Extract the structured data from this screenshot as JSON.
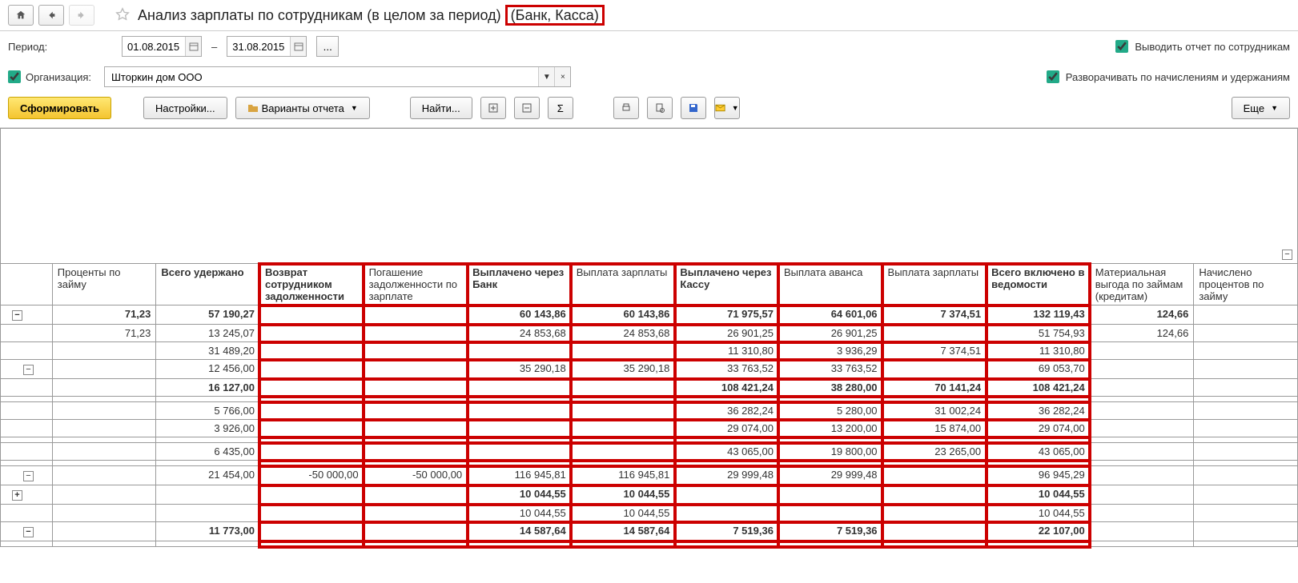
{
  "header": {
    "title_main": "Анализ зарплаты по сотрудникам (в целом за период)",
    "title_highlight": "(Банк, Касса)"
  },
  "period": {
    "label": "Период:",
    "from": "01.08.2015",
    "to": "31.08.2015"
  },
  "org": {
    "label": "Организация:",
    "value": "Шторкин дом ООО"
  },
  "options": {
    "by_employees": "Выводить отчет по сотрудникам",
    "expand": "Разворачивать по начислениям и удержаниям"
  },
  "toolbar": {
    "form": "Сформировать",
    "settings": "Настройки...",
    "variants": "Варианты отчета",
    "find": "Найти...",
    "more": "Еще"
  },
  "columns": [
    {
      "label": "Проценты по займу",
      "bold": false
    },
    {
      "label": "Всего удержано",
      "bold": true
    },
    {
      "label": "Возврат сотрудником задолженности",
      "bold": true
    },
    {
      "label": "Погашение задолженности по зарплате",
      "bold": false
    },
    {
      "label": "Выплачено через Банк",
      "bold": true
    },
    {
      "label": "Выплата зарплаты",
      "bold": false
    },
    {
      "label": "Выплачено через Кассу",
      "bold": true
    },
    {
      "label": "Выплата аванса",
      "bold": false
    },
    {
      "label": "Выплата зарплаты",
      "bold": false
    },
    {
      "label": "Всего включено в ведомости",
      "bold": true
    },
    {
      "label": "Материальная выгода по займам (кредитам)",
      "bold": false
    },
    {
      "label": "Начислено процентов по займу",
      "bold": false
    }
  ],
  "rows": [
    {
      "bold": true,
      "cells": [
        "71,23",
        "57 190,27",
        "",
        "",
        "60 143,86",
        "60 143,86",
        "71 975,57",
        "64 601,06",
        "7 374,51",
        "132 119,43",
        "124,66",
        ""
      ]
    },
    {
      "bold": false,
      "cells": [
        "71,23",
        "13 245,07",
        "",
        "",
        "24 853,68",
        "24 853,68",
        "26 901,25",
        "26 901,25",
        "",
        "51 754,93",
        "124,66",
        ""
      ]
    },
    {
      "bold": false,
      "cells": [
        "",
        "31 489,20",
        "",
        "",
        "",
        "",
        "11 310,80",
        "3 936,29",
        "7 374,51",
        "11 310,80",
        "",
        ""
      ]
    },
    {
      "bold": false,
      "cells": [
        "",
        "12 456,00",
        "",
        "",
        "35 290,18",
        "35 290,18",
        "33 763,52",
        "33 763,52",
        "",
        "69 053,70",
        "",
        ""
      ]
    },
    {
      "bold": true,
      "cells": [
        "",
        "16 127,00",
        "",
        "",
        "",
        "",
        "108 421,24",
        "38 280,00",
        "70 141,24",
        "108 421,24",
        "",
        ""
      ]
    },
    {
      "bold": false,
      "cells": [
        "",
        "",
        "",
        "",
        "",
        "",
        "",
        "",
        "",
        "",
        "",
        ""
      ]
    },
    {
      "bold": false,
      "cells": [
        "",
        "5 766,00",
        "",
        "",
        "",
        "",
        "36 282,24",
        "5 280,00",
        "31 002,24",
        "36 282,24",
        "",
        ""
      ]
    },
    {
      "bold": false,
      "cells": [
        "",
        "3 926,00",
        "",
        "",
        "",
        "",
        "29 074,00",
        "13 200,00",
        "15 874,00",
        "29 074,00",
        "",
        ""
      ]
    },
    {
      "bold": false,
      "cells": [
        "",
        "",
        "",
        "",
        "",
        "",
        "",
        "",
        "",
        "",
        "",
        ""
      ]
    },
    {
      "bold": false,
      "cells": [
        "",
        "6 435,00",
        "",
        "",
        "",
        "",
        "43 065,00",
        "19 800,00",
        "23 265,00",
        "43 065,00",
        "",
        ""
      ]
    },
    {
      "bold": false,
      "cells": [
        "",
        "",
        "",
        "",
        "",
        "",
        "",
        "",
        "",
        "",
        "",
        ""
      ]
    },
    {
      "bold": false,
      "cells": [
        "",
        "21 454,00",
        "-50 000,00",
        "-50 000,00",
        "116 945,81",
        "116 945,81",
        "29 999,48",
        "29 999,48",
        "",
        "96 945,29",
        "",
        ""
      ]
    },
    {
      "bold": true,
      "cells": [
        "",
        "",
        "",
        "",
        "10 044,55",
        "10 044,55",
        "",
        "",
        "",
        "10 044,55",
        "",
        ""
      ]
    },
    {
      "bold": false,
      "cells": [
        "",
        "",
        "",
        "",
        "10 044,55",
        "10 044,55",
        "",
        "",
        "",
        "10 044,55",
        "",
        ""
      ]
    },
    {
      "bold": true,
      "cells": [
        "",
        "11 773,00",
        "",
        "",
        "14 587,64",
        "14 587,64",
        "7 519,36",
        "7 519,36",
        "",
        "22 107,00",
        "",
        ""
      ]
    },
    {
      "bold": false,
      "cells": [
        "",
        "",
        "",
        "",
        "",
        "",
        "",
        "",
        "",
        "",
        "",
        ""
      ]
    }
  ]
}
